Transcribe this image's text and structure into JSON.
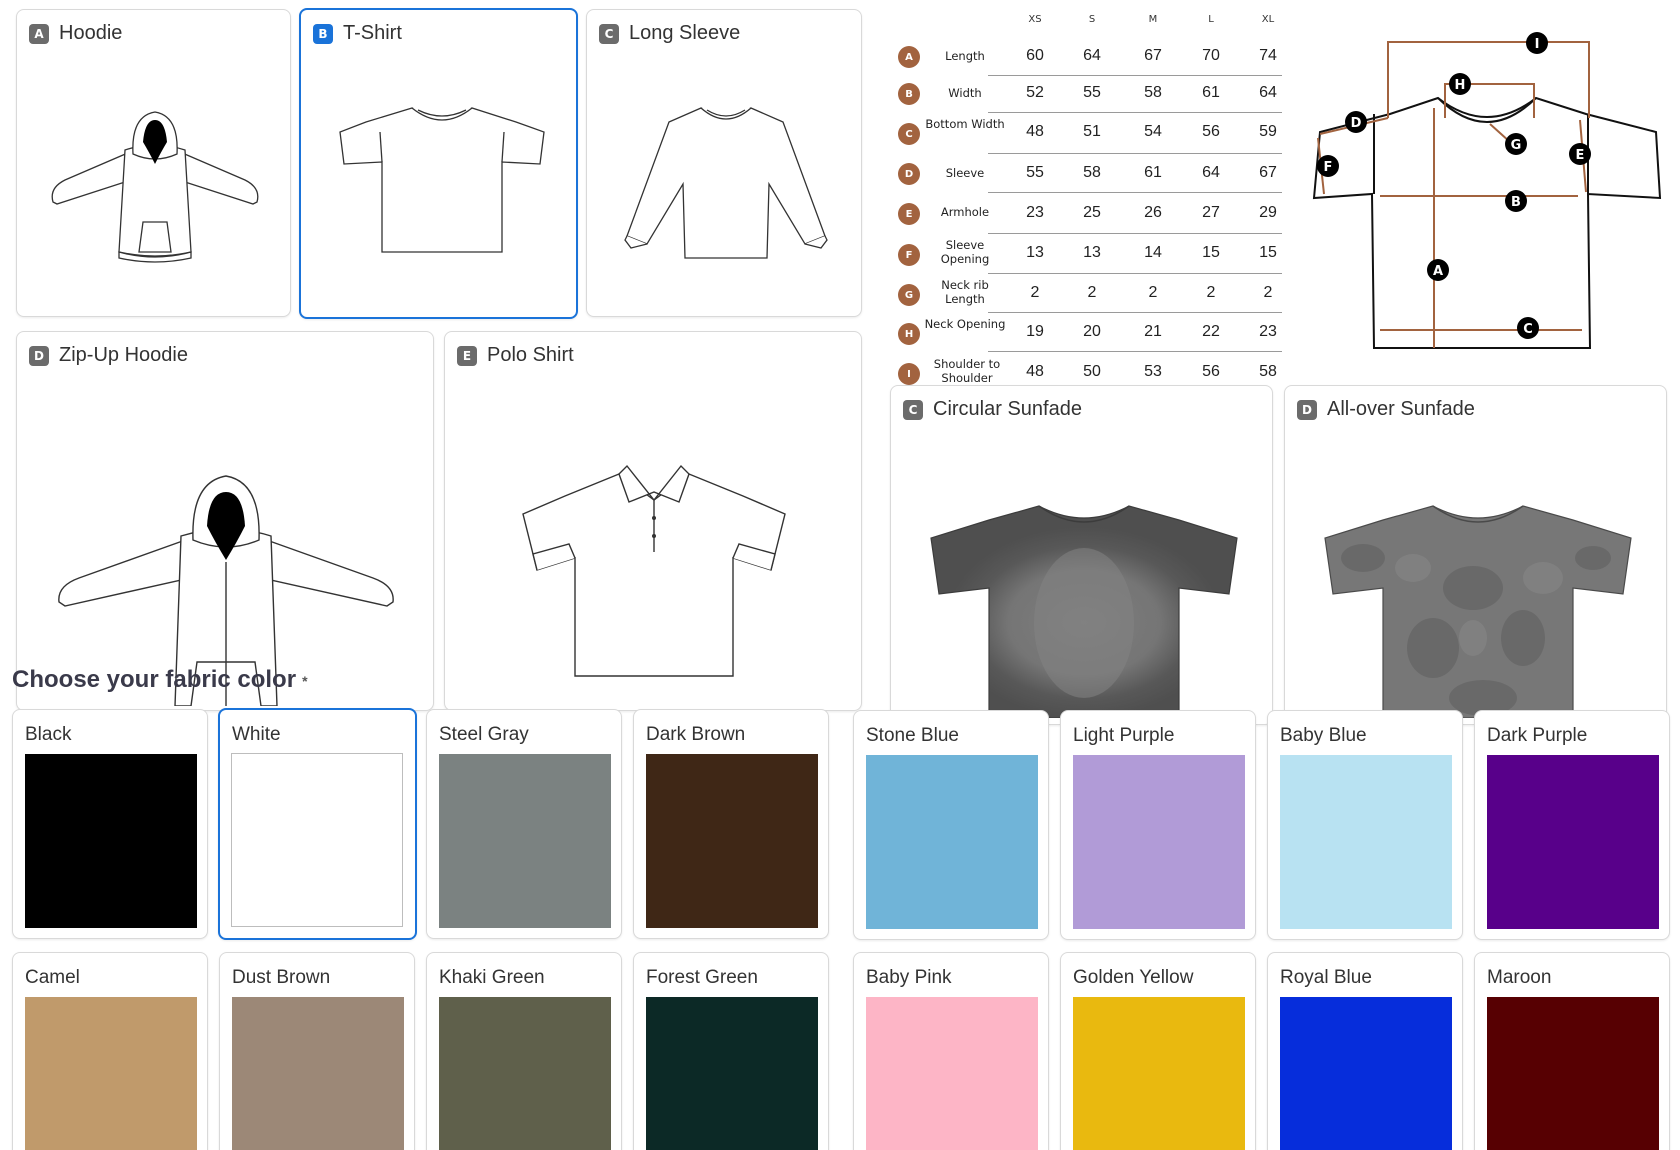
{
  "styles": [
    {
      "letter": "A",
      "name": "Hoodie"
    },
    {
      "letter": "B",
      "name": "T-Shirt"
    },
    {
      "letter": "C",
      "name": "Long Sleeve"
    },
    {
      "letter": "D",
      "name": "Zip-Up Hoodie"
    },
    {
      "letter": "E",
      "name": "Polo Shirt"
    }
  ],
  "dye_styles": [
    {
      "letter": "C",
      "name": "Circular Sunfade"
    },
    {
      "letter": "D",
      "name": "All-over Sunfade"
    }
  ],
  "selected_style": "T-Shirt",
  "size_chart": {
    "sizes": [
      "XS",
      "S",
      "M",
      "L",
      "XL"
    ],
    "rows": [
      {
        "badge": "A",
        "label": "Length",
        "values": [
          "60",
          "64",
          "67",
          "70",
          "74"
        ]
      },
      {
        "badge": "B",
        "label": "Width",
        "values": [
          "52",
          "55",
          "58",
          "61",
          "64"
        ]
      },
      {
        "badge": "C",
        "label": "Bottom Width",
        "values": [
          "48",
          "51",
          "54",
          "56",
          "59"
        ]
      },
      {
        "badge": "D",
        "label": "Sleeve",
        "values": [
          "55",
          "58",
          "61",
          "64",
          "67"
        ]
      },
      {
        "badge": "E",
        "label": "Armhole",
        "values": [
          "23",
          "25",
          "26",
          "27",
          "29"
        ]
      },
      {
        "badge": "F",
        "label": "Sleeve Opening",
        "values": [
          "13",
          "13",
          "14",
          "15",
          "15"
        ]
      },
      {
        "badge": "G",
        "label": "Neck rib Length",
        "values": [
          "2",
          "2",
          "2",
          "2",
          "2"
        ]
      },
      {
        "badge": "H",
        "label": "Neck Opening",
        "values": [
          "19",
          "20",
          "21",
          "22",
          "23"
        ]
      },
      {
        "badge": "I",
        "label": "Shoulder to Shoulder",
        "values": [
          "48",
          "50",
          "53",
          "56",
          "58"
        ]
      }
    ],
    "diagram_letters": [
      "A",
      "B",
      "C",
      "D",
      "E",
      "F",
      "G",
      "H",
      "I"
    ],
    "accent_color": "#a2633f"
  },
  "fabric": {
    "title": "Choose your fabric color",
    "required_mark": "*",
    "selected": "White",
    "colors": [
      {
        "name": "Black",
        "hex": "#000000"
      },
      {
        "name": "White",
        "hex": "#ffffff"
      },
      {
        "name": "Steel Gray",
        "hex": "#7b8281"
      },
      {
        "name": "Dark Brown",
        "hex": "#3f2716"
      },
      {
        "name": "Stone Blue",
        "hex": "#70b4d8"
      },
      {
        "name": "Light Purple",
        "hex": "#b19bd7"
      },
      {
        "name": "Baby Blue",
        "hex": "#b8e2f2"
      },
      {
        "name": "Dark Purple",
        "hex": "#58008a"
      },
      {
        "name": "Camel",
        "hex": "#c09a6b"
      },
      {
        "name": "Dust Brown",
        "hex": "#9c8877"
      },
      {
        "name": "Khaki Green",
        "hex": "#5f604b"
      },
      {
        "name": "Forest Green",
        "hex": "#0c2926"
      },
      {
        "name": "Baby Pink",
        "hex": "#fdb5c6"
      },
      {
        "name": "Golden Yellow",
        "hex": "#e9b90f"
      },
      {
        "name": "Royal Blue",
        "hex": "#062ddb"
      },
      {
        "name": "Maroon",
        "hex": "#570002"
      }
    ]
  }
}
